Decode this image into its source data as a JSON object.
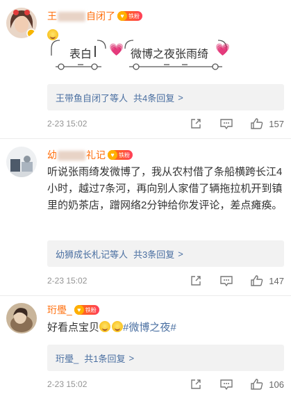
{
  "comments": [
    {
      "username_prefix": "王",
      "username_suffix": "自闭了",
      "badge": "铁粉",
      "card": {
        "left_text": "表白",
        "right_text": "微博之夜张雨绮"
      },
      "replies": {
        "who": "王带鱼自闭了等人",
        "count": "共4条回复",
        "arrow": ">"
      },
      "time": "2-23 15:02",
      "likes": "157"
    },
    {
      "username_prefix": "幼",
      "username_suffix": "礼记",
      "badge": "铁粉",
      "text": "听说张雨绮发微博了，我从农村借了条船横跨长江4小时，越过7条河，再向别人家借了辆拖拉机开到镇里的奶茶店，蹭网络2分钟给你发评论，差点瘫痪。",
      "replies": {
        "who": "幼狮成长札记等人",
        "count": "共3条回复",
        "arrow": ">"
      },
      "time": "2-23 15:02",
      "likes": "147"
    },
    {
      "username_prefix": "珩",
      "username_suffix": "璺_",
      "badge": "铁粉",
      "text_prefix": "好看点宝贝",
      "hashtag": "#微博之夜#",
      "replies": {
        "who": "珩璺_",
        "count": "共1条回复",
        "arrow": ">"
      },
      "time": "2-23 15:02",
      "likes": "106"
    }
  ],
  "icons": {
    "repost": "repost-icon",
    "comment": "comment-icon",
    "like": "thumbs-up-icon"
  },
  "colors": {
    "username": "#ff6e0b",
    "link": "#4a6fa1",
    "meta": "#939393",
    "reply_bg": "#f2f2f2"
  }
}
